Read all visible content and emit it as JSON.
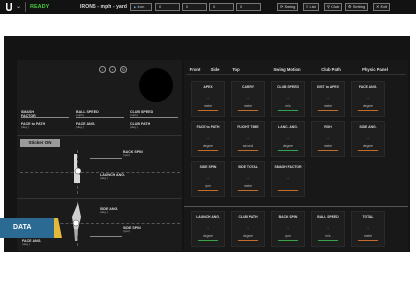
{
  "topbar": {
    "ready": "READY",
    "title": "IRON5 - mph - yard",
    "dropdown": "Iron",
    "fields": [
      "0",
      "0",
      "0",
      "0"
    ],
    "buttons": {
      "swing": "Swing",
      "list": "List",
      "club": "Club",
      "setting": "Setting",
      "exit": "Exit"
    }
  },
  "left": {
    "row1": [
      {
        "label": "SMASH",
        "label2": "FACTOR",
        "sub": "-"
      },
      {
        "label": "BALL SPEED",
        "label2": "",
        "sub": "(mph)"
      },
      {
        "label": "CLUB SPEED",
        "label2": "",
        "sub": "(mph)"
      }
    ],
    "row2": [
      {
        "label": "FACE to PATH",
        "sub": "(deg.)"
      },
      {
        "label": "FACE ANG.",
        "sub": "(deg.)"
      },
      {
        "label": "CLUB PATH",
        "sub": "(deg.)"
      }
    ],
    "sticker": "Sticker ON",
    "spin_back": {
      "label": "BACK SPIN",
      "sub": "(rpm)"
    },
    "launch": {
      "label": "LAUNCH ANG.",
      "sub": "(deg.)"
    },
    "side_ang": {
      "label": "SIDE ANG.",
      "sub": "(deg.)"
    },
    "side_spin": {
      "label": "SIDE SPIN",
      "sub": "(rpm)"
    },
    "face_ang": {
      "label": "FACE ANG.",
      "sub": "(deg.)"
    }
  },
  "tabs": [
    "Front",
    "Side",
    "Top",
    "Swing Motion",
    "Club Path",
    "Physic Panel"
  ],
  "cards_top": [
    {
      "title": "APEX",
      "value": "-",
      "unit": "meter",
      "color": "#c26b2d"
    },
    {
      "title": "CARRY",
      "value": "-",
      "unit": "meter",
      "color": "#c26b2d"
    },
    {
      "title": "CLUB SPEED",
      "value": "-",
      "unit": "m/s",
      "color": "#3aa24a"
    },
    {
      "title": "DIST to APEX",
      "value": "-",
      "unit": "meter",
      "color": "#c26b2d"
    },
    {
      "title": "FACE ANG.",
      "value": "-",
      "unit": "degree",
      "color": "#c26b2d"
    },
    {
      "title": "FACE to PATH",
      "value": "-",
      "unit": "degree",
      "color": "#c26b2d"
    },
    {
      "title": "FLIGHT TIME",
      "value": "-",
      "unit": "second",
      "color": "#c26b2d"
    },
    {
      "title": "LANC. ANG.",
      "value": "-",
      "unit": "degree",
      "color": "#3aa24a"
    },
    {
      "title": "ROH",
      "value": "-",
      "unit": "meter",
      "color": "#c26b2d"
    },
    {
      "title": "SIDE ANG.",
      "value": "-",
      "unit": "degree",
      "color": "#c26b2d"
    },
    {
      "title": "SIDE SPIN",
      "value": "-",
      "unit": "rpm",
      "color": "#c26b2d"
    },
    {
      "title": "SIDE TOTAL",
      "value": "-",
      "unit": "meter",
      "color": "#c26b2d"
    },
    {
      "title": "SMASH FACTOR",
      "value": "-",
      "unit": "",
      "color": "#c26b2d"
    }
  ],
  "cards_bottom": [
    {
      "title": "LAUNCH ANG.",
      "value": "-",
      "unit": "degree",
      "color": "#3aa24a"
    },
    {
      "title": "CLUB PATH",
      "value": "-",
      "unit": "degree",
      "color": "#c26b2d"
    },
    {
      "title": "BACK SPIN",
      "value": "-",
      "unit": "rpm",
      "color": "#3aa24a"
    },
    {
      "title": "BALL SPEED",
      "value": "-",
      "unit": "m/s",
      "color": "#3aa24a"
    },
    {
      "title": "TOTAL",
      "value": "-",
      "unit": "meter",
      "color": "#c26b2d"
    }
  ],
  "overlay_label": "DATA"
}
